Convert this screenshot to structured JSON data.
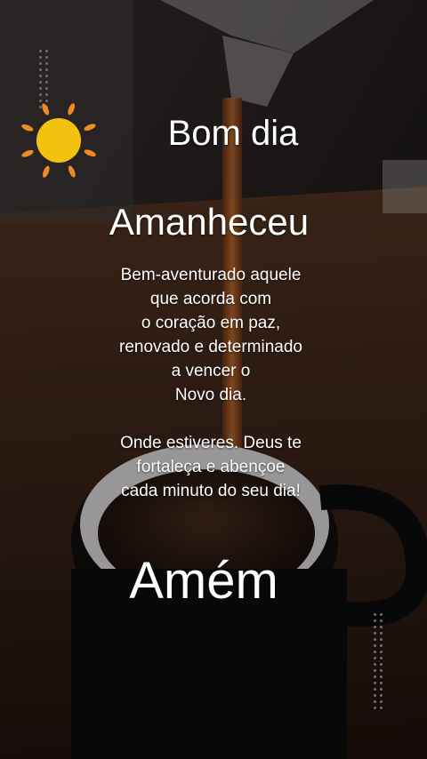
{
  "greeting": "Bom dia",
  "headline": "Amanheceu",
  "message": {
    "paragraph1": [
      "Bem-aventurado aquele",
      "que acorda com",
      "o coração em paz,",
      "renovado e determinado",
      "a vencer o",
      "Novo dia."
    ],
    "paragraph2": [
      "Onde estiveres. Deus te",
      "fortaleça e abençoe",
      "cada minuto do seu dia!"
    ]
  },
  "closing": "Amém",
  "colors": {
    "sun_core": "#f2c20f",
    "sun_rays": "#f08a24",
    "text": "#ffffff",
    "coffee": "#8a4a1f"
  },
  "icons": [
    "sun-icon"
  ]
}
